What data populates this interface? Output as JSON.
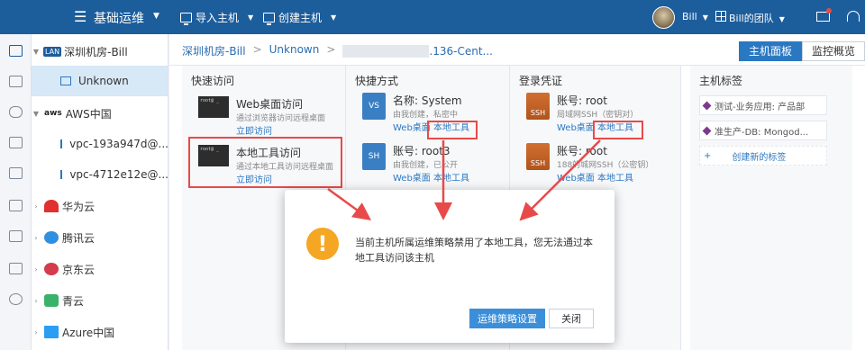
{
  "header": {
    "menu_icon": "☰",
    "app_title": "基础运维",
    "import_host": "导入主机",
    "create_host": "创建主机",
    "user": "Bill",
    "team": "Bill的团队"
  },
  "tree": {
    "root": {
      "badge": "LAN",
      "label": "深圳机房-Bill"
    },
    "unknown": "Unknown",
    "aws": {
      "badge": "aws",
      "label": "AWS中国"
    },
    "vpc1": "vpc-193a947d@...",
    "vpc2": "vpc-4712e12e@...",
    "huawei": "华为云",
    "tencent": "腾讯云",
    "jd": "京东云",
    "qing": "青云",
    "azure": "Azure中国"
  },
  "breadcrumb": {
    "item1": "深圳机房-Bill",
    "item2": "Unknown",
    "item3": ".136-Cent..."
  },
  "tabs": {
    "host_panel": "主机面板",
    "monitor": "监控概览"
  },
  "quick_access": {
    "title": "快速访问",
    "web": {
      "term": "root@ _",
      "title": "Web桌面访问",
      "desc": "通过浏览器访问远程桌面",
      "link": "立即访问"
    },
    "local": {
      "term": "root@ _",
      "title": "本地工具访问",
      "desc": "通过本地工具访问远程桌面",
      "link": "立即访问"
    }
  },
  "shortcuts": {
    "title": "快捷方式",
    "s1": {
      "name": "名称: System",
      "desc": "由我创建，私密中",
      "web": "Web桌面",
      "local": "本地工具"
    },
    "s2": {
      "name": "账号: root3",
      "desc": "由我创建，已公开",
      "web": "Web桌面",
      "local": "本地工具"
    }
  },
  "credentials": {
    "title": "登录凭证",
    "c1": {
      "name": "账号: root",
      "desc": "局域网SSH（密钥对）",
      "web": "Web桌面",
      "local": "本地工具"
    },
    "c2": {
      "name": "账号: root",
      "desc": "188的城网SSH（公密钥）",
      "web": "Web桌面",
      "local": "本地工具"
    }
  },
  "tags": {
    "title": "主机标签",
    "t1": "测试-业务应用: 产品部",
    "t2": "准生产-DB: Mongod...",
    "add": "创建新的标签"
  },
  "dialog": {
    "icon": "!",
    "message": "当前主机所属运维策略禁用了本地工具，您无法通过本地工具访问该主机",
    "primary": "运维策略设置",
    "close": "关闭"
  },
  "colors": {
    "header_bg": "#1c5d9c",
    "accent": "#2b78c2",
    "warning": "#f5a623",
    "highlight": "#e84a4a"
  }
}
